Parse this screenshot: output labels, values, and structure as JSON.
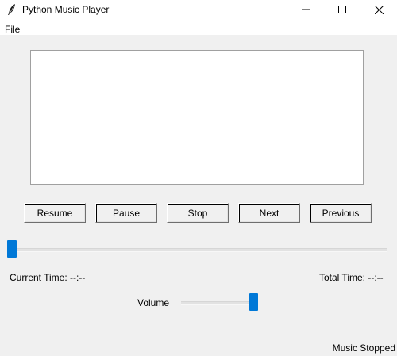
{
  "window": {
    "title": "Python Music Player",
    "icon": "feather-icon"
  },
  "menu": {
    "items": [
      {
        "label": "File"
      }
    ]
  },
  "playlist": {
    "items": []
  },
  "controls": {
    "resume_label": "Resume",
    "pause_label": "Pause",
    "stop_label": "Stop",
    "next_label": "Next",
    "previous_label": "Previous"
  },
  "seek": {
    "progress_fraction": 0.0
  },
  "time": {
    "current": "Current Time: --:--",
    "total": "Total Time: --:--"
  },
  "volume": {
    "label": "Volume",
    "level_fraction": 1.0
  },
  "status": {
    "text": "Music Stopped"
  },
  "colors": {
    "slider_accent": "#0078d7",
    "client_background": "#f0f0f0"
  }
}
